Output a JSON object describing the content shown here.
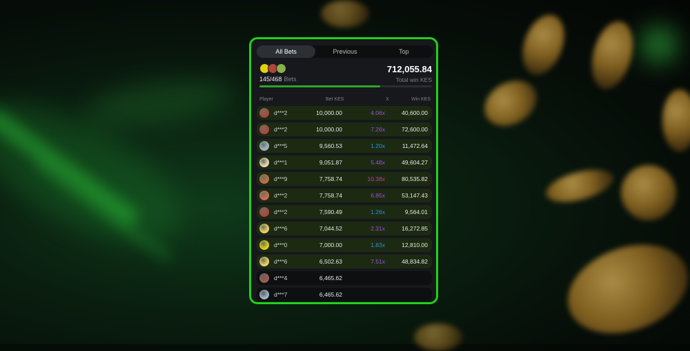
{
  "tabs": [
    "All Bets",
    "Previous",
    "Top"
  ],
  "summary": {
    "bets_count": "145/468",
    "bets_label": "Bets",
    "total_win": "712,055.84",
    "total_win_label": "Total win KES",
    "progress_fraction": 0.698
  },
  "columns": {
    "player": "Player",
    "bet": "Bet KES",
    "mult": "X",
    "win": "Win KES"
  },
  "rows": [
    {
      "player": "d***2",
      "bet": "10,000.00",
      "mult": "4.06x",
      "win": "40,600.00",
      "mult_color": "#9b4fd9",
      "avatar": "#b0453c",
      "won": true
    },
    {
      "player": "d***2",
      "bet": "10,000.00",
      "mult": "7.26x",
      "win": "72,600.00",
      "mult_color": "#9b4fd9",
      "avatar": "#b0453c",
      "won": true
    },
    {
      "player": "d***5",
      "bet": "9,560.53",
      "mult": "1.20x",
      "win": "11,472.64",
      "mult_color": "#2f8fd8",
      "avatar": "#9db5c8",
      "won": true
    },
    {
      "player": "d***1",
      "bet": "9,051.87",
      "mult": "5.48x",
      "win": "49,604.27",
      "mult_color": "#9b4fd9",
      "avatar": "#e8d8b0",
      "won": true
    },
    {
      "player": "d***9",
      "bet": "7,758.74",
      "mult": "10.38x",
      "win": "80,535.82",
      "mult_color": "#c23aa8",
      "avatar": "#c07040",
      "won": true
    },
    {
      "player": "d***2",
      "bet": "7,758.74",
      "mult": "6.85x",
      "win": "53,147.43",
      "mult_color": "#9b4fd9",
      "avatar": "#d06a50",
      "won": true
    },
    {
      "player": "d***2",
      "bet": "7,590.49",
      "mult": "1.26x",
      "win": "9,564.01",
      "mult_color": "#2f8fd8",
      "avatar": "#b0453c",
      "won": true
    },
    {
      "player": "d***6",
      "bet": "7,044.52",
      "mult": "2.31x",
      "win": "16,272.85",
      "mult_color": "#9b4fd9",
      "avatar": "#f0d060",
      "won": true
    },
    {
      "player": "d***0",
      "bet": "7,000.00",
      "mult": "1.83x",
      "win": "12,810.00",
      "mult_color": "#2f8fd8",
      "avatar": "#e0d010",
      "won": true
    },
    {
      "player": "d***6",
      "bet": "6,502.63",
      "mult": "7.51x",
      "win": "48,834.82",
      "mult_color": "#9b4fd9",
      "avatar": "#f0d060",
      "won": true
    },
    {
      "player": "d***4",
      "bet": "6,465.62",
      "mult": "",
      "win": "",
      "mult_color": "#9b4fd9",
      "avatar": "#a05a50",
      "won": false
    },
    {
      "player": "d***7",
      "bet": "6,465.62",
      "mult": "",
      "win": "",
      "mult_color": "#9b4fd9",
      "avatar": "#9db5c8",
      "won": false
    }
  ],
  "colors": {
    "accent_border": "#22d01c",
    "win_row_bg": "#1d2a12",
    "panel_bg": "#16181b"
  }
}
